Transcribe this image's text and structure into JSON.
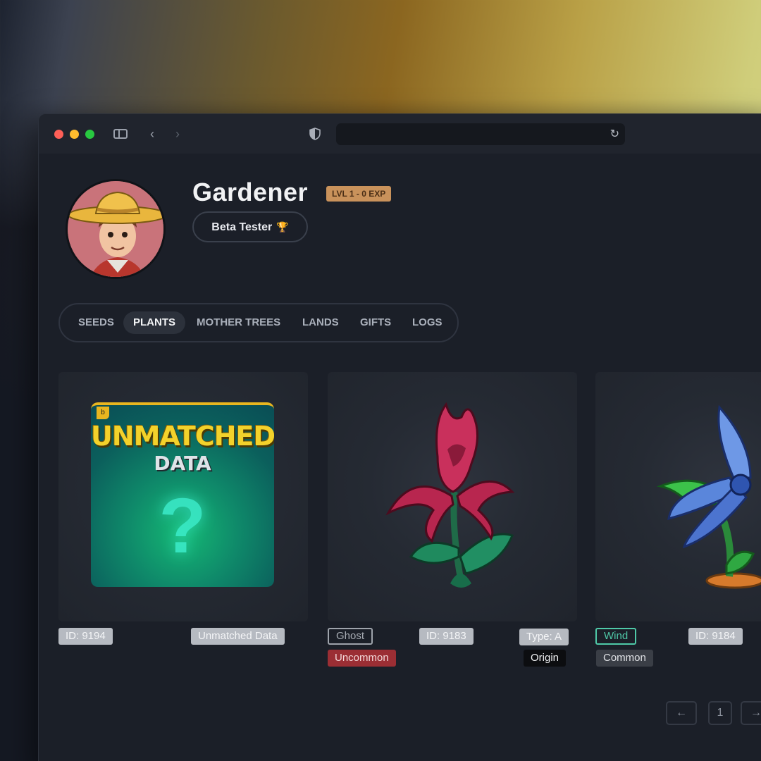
{
  "browser": {
    "url": "",
    "icons": [
      "sidebar-icon",
      "back-icon",
      "forward-icon",
      "shield-icon",
      "reload-icon"
    ]
  },
  "profile": {
    "name": "Gardener",
    "level": "LVL 1 - 0 EXP",
    "badge": "Beta Tester",
    "badge_icon": "trophy-icon"
  },
  "tabs": [
    {
      "label": "SEEDS",
      "active": false
    },
    {
      "label": "PLANTS",
      "active": true
    },
    {
      "label": "MOTHER TREES",
      "active": false
    },
    {
      "label": "LANDS",
      "active": false
    },
    {
      "label": "GIFTS",
      "active": false
    },
    {
      "label": "LOGS",
      "active": false
    }
  ],
  "cards": [
    {
      "image": "unmatched-data-placeholder",
      "image_text": {
        "title": "UNMATCHED",
        "subtitle": "DATA"
      },
      "id": "ID: 9194",
      "name": "Unmatched Data"
    },
    {
      "image": "red-flower-plant",
      "element": "Ghost",
      "rarity": "Uncommon",
      "id": "ID: 9183",
      "type": "Type: A",
      "origin": "Origin"
    },
    {
      "image": "blue-flower-plant",
      "element": "Wind",
      "rarity": "Common",
      "id": "ID: 9184"
    }
  ],
  "pagination": {
    "prev": "←",
    "page": "1",
    "next": "→"
  },
  "colors": {
    "accent_level": "#c9925b",
    "rarity_uncommon": "#9b2e34",
    "element_wind": "#4fc9a8"
  }
}
